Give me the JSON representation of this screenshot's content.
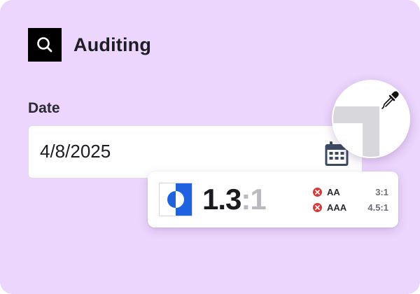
{
  "header": {
    "title": "Auditing",
    "icon": "search-icon"
  },
  "date_field": {
    "label": "Date",
    "value": "4/8/2025",
    "icon": "calendar-icon"
  },
  "contrast": {
    "ratio": "1.3",
    "suffix": ":1",
    "checks": [
      {
        "level": "AA",
        "required": "3:1",
        "status": "fail"
      },
      {
        "level": "AAA",
        "required": "4.5:1",
        "status": "fail"
      }
    ],
    "swatch_colors": {
      "foreground": "#1f62e0",
      "background": "#ffffff"
    }
  },
  "magnifier": {
    "icon": "eyedropper-icon"
  },
  "colors": {
    "background": "#ecd6fd",
    "accent": "#1f62e0",
    "fail": "#d63a3a",
    "calendar": "#3b4a62"
  }
}
